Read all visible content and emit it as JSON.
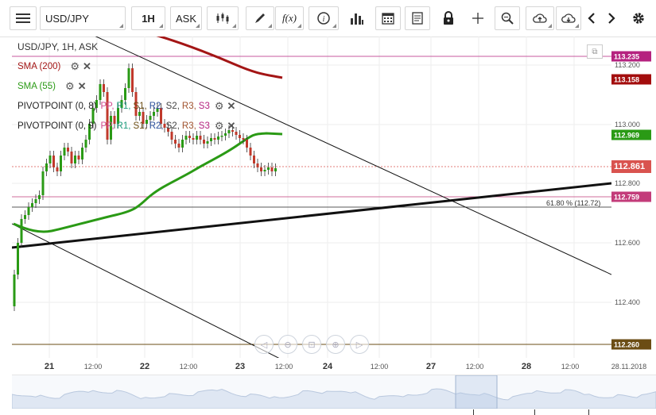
{
  "toolbar": {
    "symbol": "USD/JPY",
    "timeframe": "1H",
    "price_type": "ASK",
    "fx_label": "f(x)"
  },
  "chart_header": "USD/JPY, 1H, ASK",
  "legend": {
    "sma200": "SMA (200)",
    "sma55": "SMA (55)",
    "pivot1": "PIVOTPOINT (0, 8)",
    "pivot2": "PIVOTPOINT (0, 9)",
    "pivot_levels": [
      "PP,",
      "R1,",
      "S1,",
      "R2,",
      "S2,",
      "R3,",
      "S3"
    ]
  },
  "colors": {
    "sma200": "#a31515",
    "sma55": "#2a9a15",
    "badge_dark": "#a30d0d",
    "badge_green": "#2a9a15",
    "badge_red": "#d9534f",
    "badge_pink": "#c33c7a",
    "badge_olive": "#6b4d14",
    "badge_magenta": "#b5227f",
    "candle_up": "#2a9a15",
    "candle_down": "#c0392b"
  },
  "price_axis": {
    "ticks": [
      "113.200",
      "113.000",
      "112.800",
      "112.600",
      "112.400"
    ],
    "badges": [
      {
        "label": "113.235",
        "color": "#b5227f"
      },
      {
        "label": "113.158",
        "color": "#a30d0d"
      },
      {
        "label": "112.969",
        "color": "#2a9a15"
      },
      {
        "label": "112.861",
        "color": "#d9534f"
      },
      {
        "label": "112.759",
        "color": "#c33c7a"
      },
      {
        "label": "112.260",
        "color": "#6b4d14"
      }
    ]
  },
  "fib_label": "61.80 % (112.72)",
  "time_axis": {
    "ticks": [
      "21",
      "12:00",
      "22",
      "12:00",
      "23",
      "12:00",
      "24",
      "12:00",
      "27",
      "12:00",
      "28",
      "12:00",
      "28.11.2018"
    ]
  },
  "icons": [
    "menu-icon",
    "candles-icon",
    "pencil-icon",
    "info-icon",
    "bars-icon",
    "calendar-icon",
    "news-icon",
    "lock-icon",
    "crosshair-icon",
    "zoom-icon",
    "cloud-upload-icon",
    "cloud-download-icon",
    "chevron-left-icon",
    "chevron-right-icon",
    "gear-icon"
  ]
}
